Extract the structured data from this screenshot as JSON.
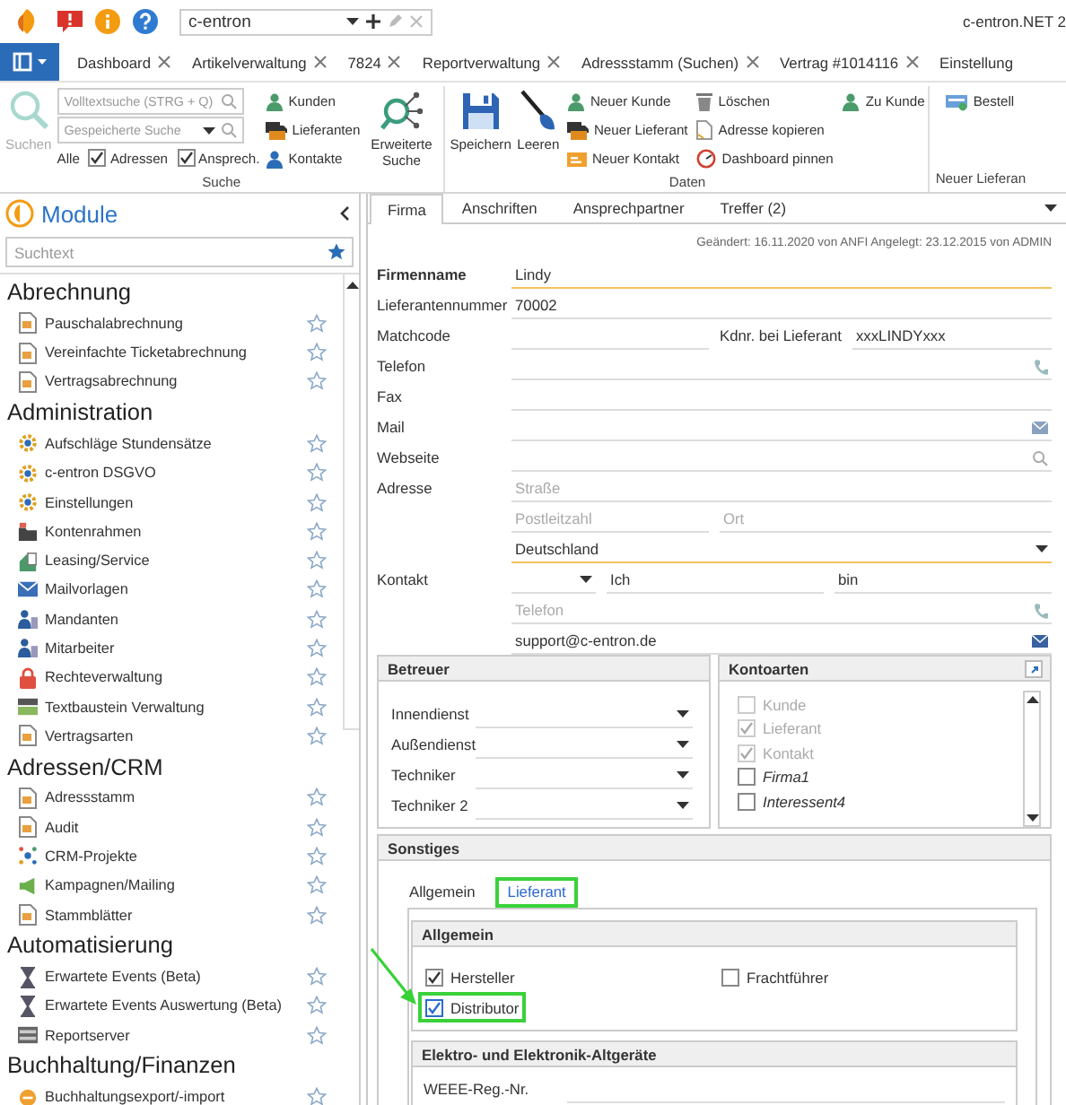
{
  "title_bar": {
    "quick_search": "c-entron",
    "app_title": "c-entron.NET 2"
  },
  "document_tabs": [
    {
      "label": "Dashboard",
      "closable": true
    },
    {
      "label": "Artikelverwaltung",
      "closable": true
    },
    {
      "label": "7824",
      "closable": true
    },
    {
      "label": "Reportverwaltung",
      "closable": true
    },
    {
      "label": "Adressstamm (Suchen)",
      "closable": true
    },
    {
      "label": "Vertrag #1014116",
      "closable": true
    },
    {
      "label": "Einstellung",
      "closable": false
    }
  ],
  "ribbon": {
    "search": {
      "label": "Suche",
      "button": {
        "label": "Suchen",
        "disabled": true
      },
      "fulltext": {
        "placeholder": "Volltextsuche (STRG + Q)"
      },
      "saved_search": {
        "placeholder": "Gespeicherte Suche"
      },
      "scope_label": "Alle",
      "filters": [
        {
          "label": "Adressen",
          "checked": true
        },
        {
          "label": "Ansprech.",
          "checked": true
        }
      ],
      "links": [
        "Kunden",
        "Lieferanten",
        "Kontakte"
      ],
      "advanced": "Erweiterte Suche"
    },
    "data": {
      "label": "Daten",
      "buttons": [
        "Speichern",
        "Leeren"
      ],
      "columns": [
        [
          "Neuer Kunde",
          "Neuer Lieferant",
          "Neuer Kontakt"
        ],
        [
          "Löschen",
          "Adresse kopieren",
          "Dashboard pinnen"
        ],
        [
          "Zu Kunde"
        ]
      ]
    },
    "new_supplier": {
      "label": "Neuer Lieferan",
      "buttons": [
        "Bestell"
      ]
    }
  },
  "modules": {
    "title": "Module",
    "search_placeholder": "Suchtext",
    "sections": [
      {
        "title": "Abrechnung",
        "items": [
          "Pauschalabrechnung",
          "Vereinfachte Ticketabrechnung",
          "Vertragsabrechnung"
        ]
      },
      {
        "title": "Administration",
        "items": [
          "Aufschläge Stundensätze",
          "c-entron DSGVO",
          "Einstellungen",
          "Kontenrahmen",
          "Leasing/Service",
          "Mailvorlagen",
          "Mandanten",
          "Mitarbeiter",
          "Rechteverwaltung",
          "Textbaustein Verwaltung",
          "Vertragsarten"
        ]
      },
      {
        "title": "Adressen/CRM",
        "items": [
          "Adressstamm",
          "Audit",
          "CRM-Projekte",
          "Kampagnen/Mailing",
          "Stammblätter"
        ]
      },
      {
        "title": "Automatisierung",
        "items": [
          "Erwartete Events (Beta)",
          "Erwartete Events Auswertung (Beta)",
          "Reportserver"
        ]
      },
      {
        "title": "Buchhaltung/Finanzen",
        "items": [
          "Buchhaltungsexport/-import"
        ]
      }
    ]
  },
  "form": {
    "tabs": [
      {
        "label": "Firma",
        "selected": true
      },
      {
        "label": "Anschriften",
        "selected": false
      },
      {
        "label": "Ansprechpartner",
        "selected": false
      },
      {
        "label": "Treffer (2)",
        "selected": false
      }
    ],
    "meta": "Geändert: 16.11.2020 von ANFI Angelegt: 23.12.2015 von ADMIN",
    "rows": [
      {
        "kind": "text",
        "label": "Firmenname",
        "value": "Lindy",
        "required": true
      },
      {
        "kind": "text",
        "label": "Lieferantennummer",
        "value": "70002",
        "required": false
      },
      {
        "kind": "split",
        "label": "Matchcode",
        "second_label": "Kdnr. bei Lieferant",
        "second_value": "xxxLINDYxxx"
      },
      {
        "kind": "phone",
        "label": "Telefon"
      },
      {
        "kind": "text",
        "label": "Fax",
        "required": false
      },
      {
        "kind": "mail",
        "label": "Mail"
      },
      {
        "kind": "web",
        "label": "Webseite"
      },
      {
        "kind": "text",
        "label": "Adresse",
        "placeholder": "Straße",
        "required": false
      },
      {
        "kind": "pair",
        "placeholders": [
          "Postleitzahl",
          "Ort"
        ]
      },
      {
        "kind": "select",
        "value": "Deutschland",
        "required": true
      },
      {
        "kind": "contact",
        "label": "Kontakt",
        "values": [
          "Ich",
          "bin"
        ]
      },
      {
        "kind": "phone",
        "placeholder": "Telefon"
      },
      {
        "kind": "mail",
        "value": "support@c-entron.de"
      }
    ],
    "supervisors": {
      "title": "Betreuer",
      "fields": [
        "Innendienst",
        "Außendienst",
        "Techniker",
        "Techniker 2"
      ]
    },
    "account_types": {
      "title": "Kontoarten",
      "items": [
        {
          "label": "Kunde",
          "checked": false,
          "disabled": true
        },
        {
          "label": "Lieferant",
          "checked": true,
          "disabled": true
        },
        {
          "label": "Kontakt",
          "checked": true,
          "disabled": true
        },
        {
          "label": "Firma1",
          "checked": false,
          "disabled": false
        },
        {
          "label": "Interessent4",
          "checked": false,
          "disabled": false
        }
      ]
    },
    "other": {
      "title": "Sonstiges",
      "tabs": [
        {
          "label": "Allgemein",
          "selected": false,
          "highlighted": false
        },
        {
          "label": "Lieferant",
          "selected": true,
          "highlighted": true
        }
      ],
      "general": {
        "title": "Allgemein",
        "options": [
          {
            "label": "Hersteller",
            "checked": true,
            "highlighted": false
          },
          {
            "label": "Frachtführer",
            "checked": false,
            "highlighted": false
          },
          {
            "label": "Distributor",
            "checked": true,
            "highlighted": true
          }
        ]
      },
      "weee": {
        "title": "Elektro- und Elektronik-Altgeräte",
        "fields": [
          "WEEE-Reg.-Nr."
        ]
      }
    }
  }
}
